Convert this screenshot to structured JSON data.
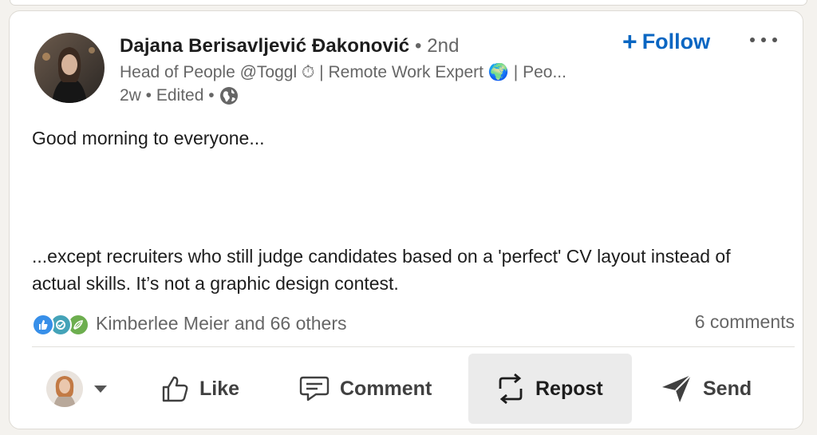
{
  "author": {
    "name": "Dajana Berisavljević Đakonović",
    "degree": "• 2nd",
    "headline": "Head of People @Toggl ⏱ | Remote Work Expert 🌍 | Peo...",
    "meta": "2w • Edited •",
    "visibility_icon": "globe-icon"
  },
  "follow": {
    "plus": "+",
    "label": "Follow"
  },
  "post": {
    "line1": "Good morning to everyone...",
    "line2": "...except recruiters who still judge candidates based on a 'perfect' CV layout instead of actual skills. It’s not a graphic design contest."
  },
  "social": {
    "reactors": "Kimberlee Meier and 66 others",
    "comments": "6 comments",
    "reaction_icons": [
      "like-icon",
      "celebrate-icon",
      "support-icon"
    ]
  },
  "actions": {
    "like": "Like",
    "comment": "Comment",
    "repost": "Repost",
    "send": "Send"
  },
  "colors": {
    "accent": "#0a66c2",
    "like_blue": "#378fe9",
    "celebrate_teal": "#44a3b8",
    "support_green": "#6dae4f"
  }
}
